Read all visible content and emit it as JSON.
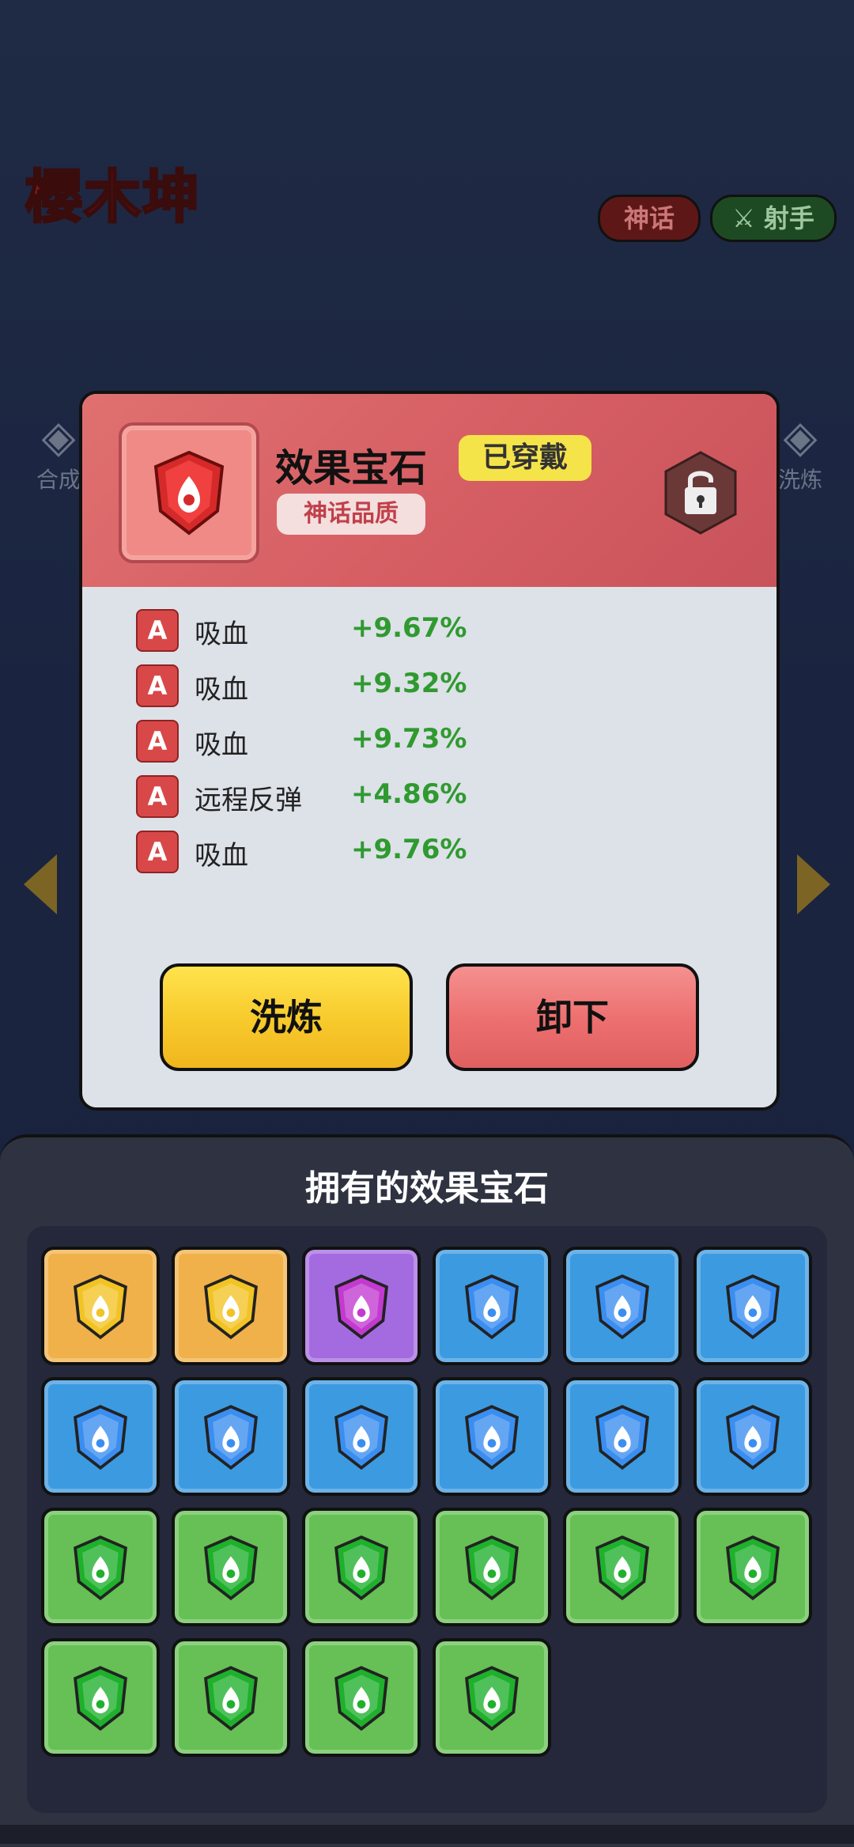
{
  "hero": {
    "name": "樱木坤",
    "tags": [
      "神话",
      "射手"
    ]
  },
  "side_buttons": {
    "left": "合成",
    "right": "洗炼"
  },
  "popup": {
    "title": "效果宝石",
    "status": "已穿戴",
    "quality": "神话品质",
    "gem_color": "#e03434",
    "stats": [
      {
        "grade": "A",
        "name": "吸血",
        "value": "+9.67%"
      },
      {
        "grade": "A",
        "name": "吸血",
        "value": "+9.32%"
      },
      {
        "grade": "A",
        "name": "吸血",
        "value": "+9.73%"
      },
      {
        "grade": "A",
        "name": "远程反弹",
        "value": "+4.86%"
      },
      {
        "grade": "A",
        "name": "吸血",
        "value": "+9.76%"
      }
    ],
    "buttons": {
      "refine": "洗炼",
      "unequip": "卸下"
    }
  },
  "inventory": {
    "title": "拥有的效果宝石",
    "gems": [
      "gold",
      "gold",
      "purple",
      "blue",
      "blue",
      "blue",
      "blue",
      "blue",
      "blue",
      "blue",
      "blue",
      "blue",
      "green",
      "green",
      "green",
      "green",
      "green",
      "green",
      "green",
      "green",
      "green",
      "green"
    ]
  },
  "colors": {
    "gold": {
      "bg": "#f0b14a",
      "gem": "#f2c324"
    },
    "purple": {
      "bg": "#a46be0",
      "gem": "#c23ad0"
    },
    "blue": {
      "bg": "#3c9ae0",
      "gem": "#3a8ef0"
    },
    "green": {
      "bg": "#66c055",
      "gem": "#1fb02c"
    }
  }
}
